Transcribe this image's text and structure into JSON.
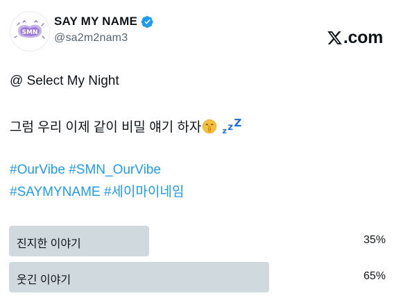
{
  "account": {
    "display_name": "SAY MY NAME",
    "handle": "@sa2m2nam3",
    "verified_icon": "verified-badge-icon",
    "avatar_icon": "group-logo-avatar",
    "verified_color": "#1d9bf0"
  },
  "site": {
    "label": "X.com",
    "suffix": ".com",
    "logo_icon": "x-logo-icon"
  },
  "post": {
    "line1": "@ Select My Night",
    "line2_text": "그럼 우리 이제 같이 비밀 얘기 하자",
    "line2_emojis": [
      "shushing-face-emoji",
      "zzz-emoji"
    ],
    "hashtags_line1": [
      "#OurVibe",
      "#SMN_OurVibe"
    ],
    "hashtags_line2": [
      "#SAYMYNAME",
      "#세이마이네임"
    ],
    "hashtag_color": "#1d9bf0"
  },
  "poll": {
    "options": [
      {
        "label": "진지한 이야기",
        "percent_text": "35%",
        "percent": 35
      },
      {
        "label": "웃긴 이야기",
        "percent_text": "65%",
        "percent": 65
      }
    ],
    "bar_color": "#cfd9de"
  }
}
